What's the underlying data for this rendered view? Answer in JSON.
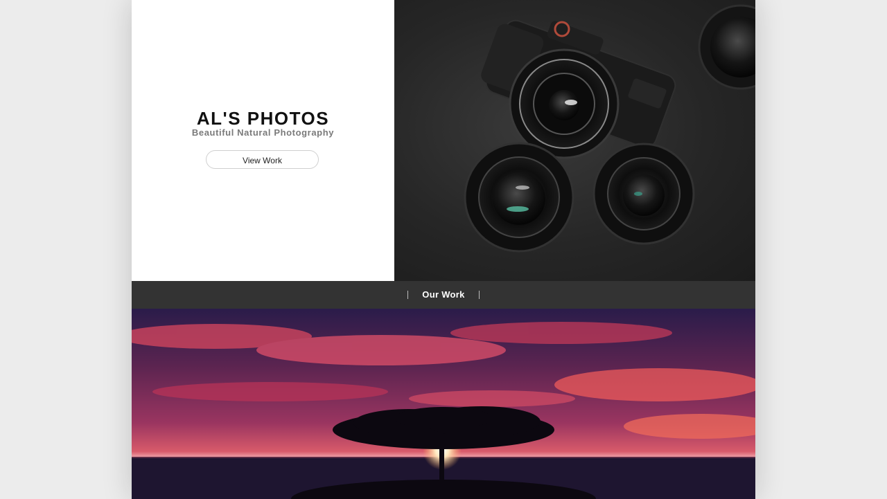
{
  "hero": {
    "title": "AL'S PHOTOS",
    "subtitle": "Beautiful Natural Photography",
    "button_label": "View Work"
  },
  "section": {
    "title": "Our Work"
  },
  "images": {
    "hero_image": "camera-with-lenses-photo",
    "work_image": "tree-at-sunset-photo"
  },
  "colors": {
    "page_background": "#ececec",
    "section_bar": "#333333",
    "sky_red": "#d83a55",
    "sky_purple": "#2a1c4a"
  }
}
